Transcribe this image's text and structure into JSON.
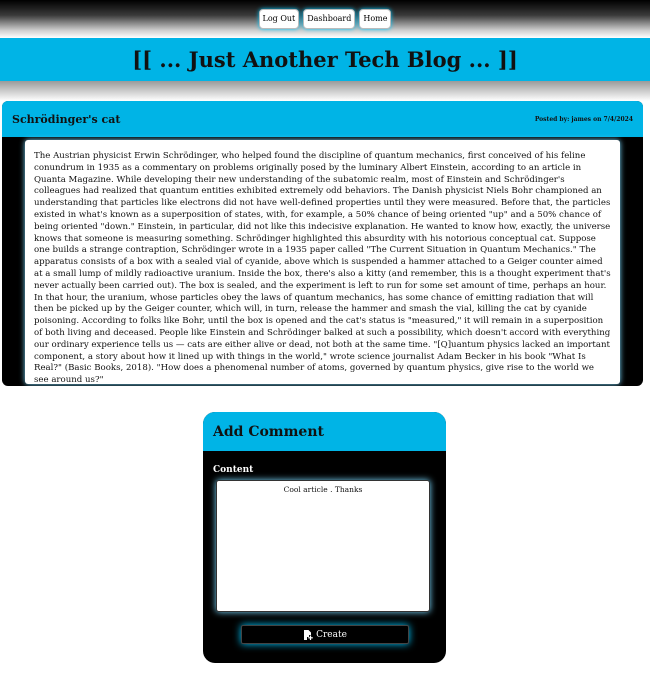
{
  "nav": {
    "logout_label": "Log Out",
    "dashboard_label": "Dashboard",
    "home_label": "Home"
  },
  "site": {
    "title": "[[ ... Just Another Tech Blog ... ]]"
  },
  "post": {
    "title": "Schrödinger's cat",
    "meta": "Posted by: james on 7/4/2024",
    "body": "The Austrian physicist Erwin Schrödinger, who helped found the discipline of quantum mechanics, first conceived of his feline conundrum in 1935 as a commentary on problems originally posed by the luminary Albert Einstein, according to an article in Quanta Magazine. While developing their new understanding of the subatomic realm, most of Einstein and Schrödinger's colleagues had realized that quantum entities exhibited extremely odd behaviors. The Danish physicist Niels Bohr championed an understanding that particles like electrons did not have well-defined properties until they were measured. Before that, the particles existed in what's known as a superposition of states, with, for example, a 50% chance of being oriented \"up\" and a 50% chance of being oriented \"down.\" Einstein, in particular, did not like this indecisive explanation. He wanted to know how, exactly, the universe knows that someone is measuring something. Schrödinger highlighted this absurdity with his notorious conceptual cat. Suppose one builds a strange contraption, Schrödinger wrote in a 1935 paper called \"The Current Situation in Quantum Mechanics.\" The apparatus consists of a box with a sealed vial of cyanide, above which is suspended a hammer attached to a Geiger counter aimed at a small lump of mildly radioactive uranium. Inside the box, there's also a kitty (and remember, this is a thought experiment that's never actually been carried out). The box is sealed, and the experiment is left to run for some set amount of time, perhaps an hour. In that hour, the uranium, whose particles obey the laws of quantum mechanics, has some chance of emitting radiation that will then be picked up by the Geiger counter, which will, in turn, release the hammer and smash the vial, killing the cat by cyanide poisoning. According to folks like Bohr, until the box is opened and the cat's status is \"measured,\" it will remain in a superposition of both living and deceased. People like Einstein and Schrödinger balked at such a possibility, which doesn't accord with everything our ordinary experience tells us — cats are either alive or dead, not both at the same time. \"[Q]uantum physics lacked an important component, a story about how it lined up with things in the world,\" wrote science journalist Adam Becker in his book \"What Is Real?\" (Basic Books, 2018). \"How does a phenomenal number of atoms, governed by quantum physics, give rise to the world we see around us?\""
  },
  "comment_form": {
    "title": "Add Comment",
    "content_label": "Content",
    "content_value": "Cool article . Thanks",
    "create_label": "Create",
    "create_icon": "file-plus-icon"
  },
  "colors": {
    "accent": "#00b4e6",
    "glow": "#00c8ff",
    "panel": "#000000"
  }
}
